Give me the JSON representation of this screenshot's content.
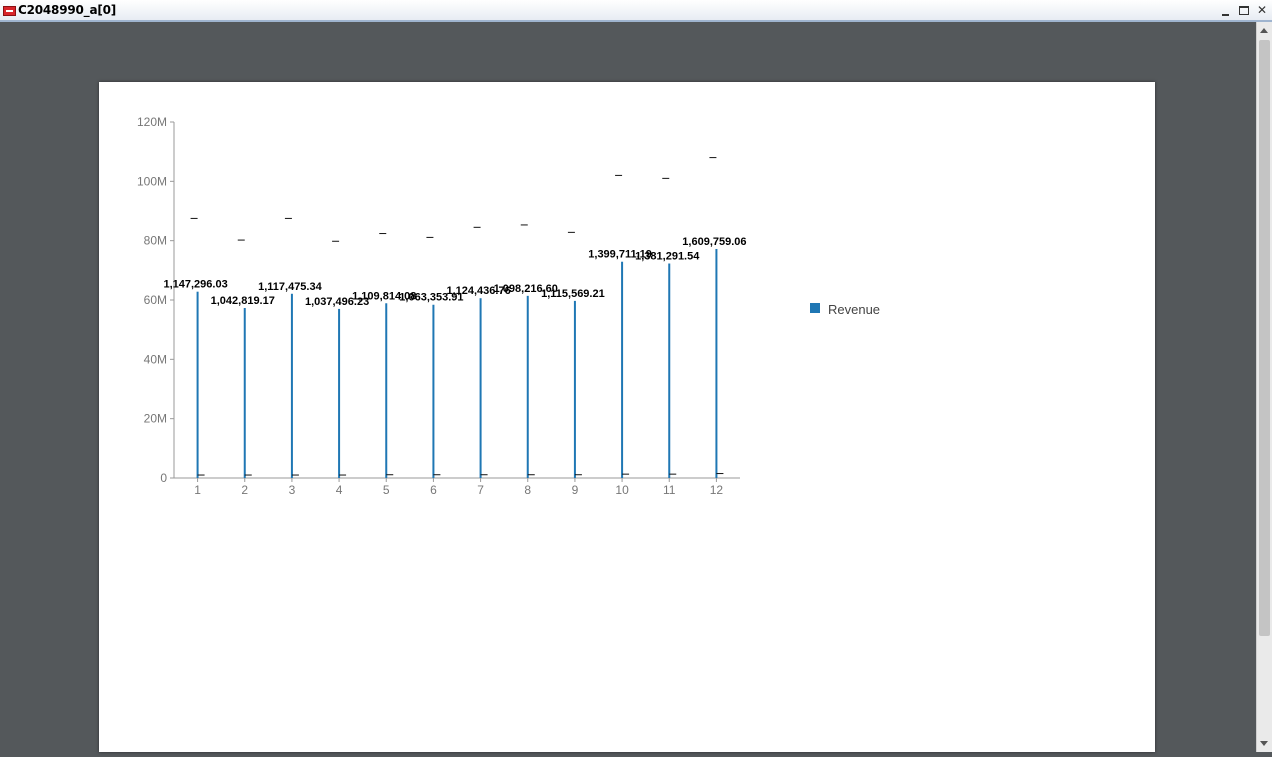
{
  "window": {
    "title": "C2048990_a[0]"
  },
  "icons": {
    "app": "pdf-app-icon",
    "minimize": "minimize-icon",
    "maximize": "maximize-icon",
    "close": "close-icon"
  },
  "colors": {
    "series": "#1f77b4",
    "background": "#54585b",
    "page": "#ffffff"
  },
  "chart_data": {
    "type": "bar",
    "title": "",
    "xlabel": "",
    "ylabel": "",
    "categories": [
      "1",
      "2",
      "3",
      "4",
      "5",
      "6",
      "7",
      "8",
      "9",
      "10",
      "11",
      "12"
    ],
    "series": [
      {
        "name": "Revenue",
        "values": [
          62800000,
          57300000,
          62100000,
          57000000,
          58900000,
          58400000,
          60600000,
          61400000,
          59700000,
          72900000,
          72300000,
          77200000
        ],
        "value_labels": [
          "1,147,296.03",
          "1,042,819.17",
          "1,117,475.34",
          "1,037,496.23",
          "1,109,814.08",
          "1,063,353.91",
          "1,124,436.76",
          "1,098,216.60",
          "1,115,569.21",
          "1,399,711.19",
          "1,381,291.54",
          "1,609,759.06"
        ],
        "upper_marks": [
          87500000,
          80200000,
          87500000,
          79800000,
          82400000,
          81100000,
          84500000,
          85300000,
          82800000,
          102000000,
          101000000,
          108000000
        ],
        "lower_marks": [
          1000000,
          1000000,
          1000000,
          1000000,
          1100000,
          1100000,
          1100000,
          1100000,
          1100000,
          1300000,
          1300000,
          1500000
        ]
      }
    ],
    "ylim": [
      0,
      120000000
    ],
    "yticks": [
      0,
      20000000,
      40000000,
      60000000,
      80000000,
      100000000,
      120000000
    ],
    "ytick_labels": [
      "0",
      "20M",
      "40M",
      "60M",
      "80M",
      "100M",
      "120M"
    ],
    "legend": {
      "position": "right",
      "entries": [
        "Revenue"
      ]
    },
    "grid": false
  }
}
